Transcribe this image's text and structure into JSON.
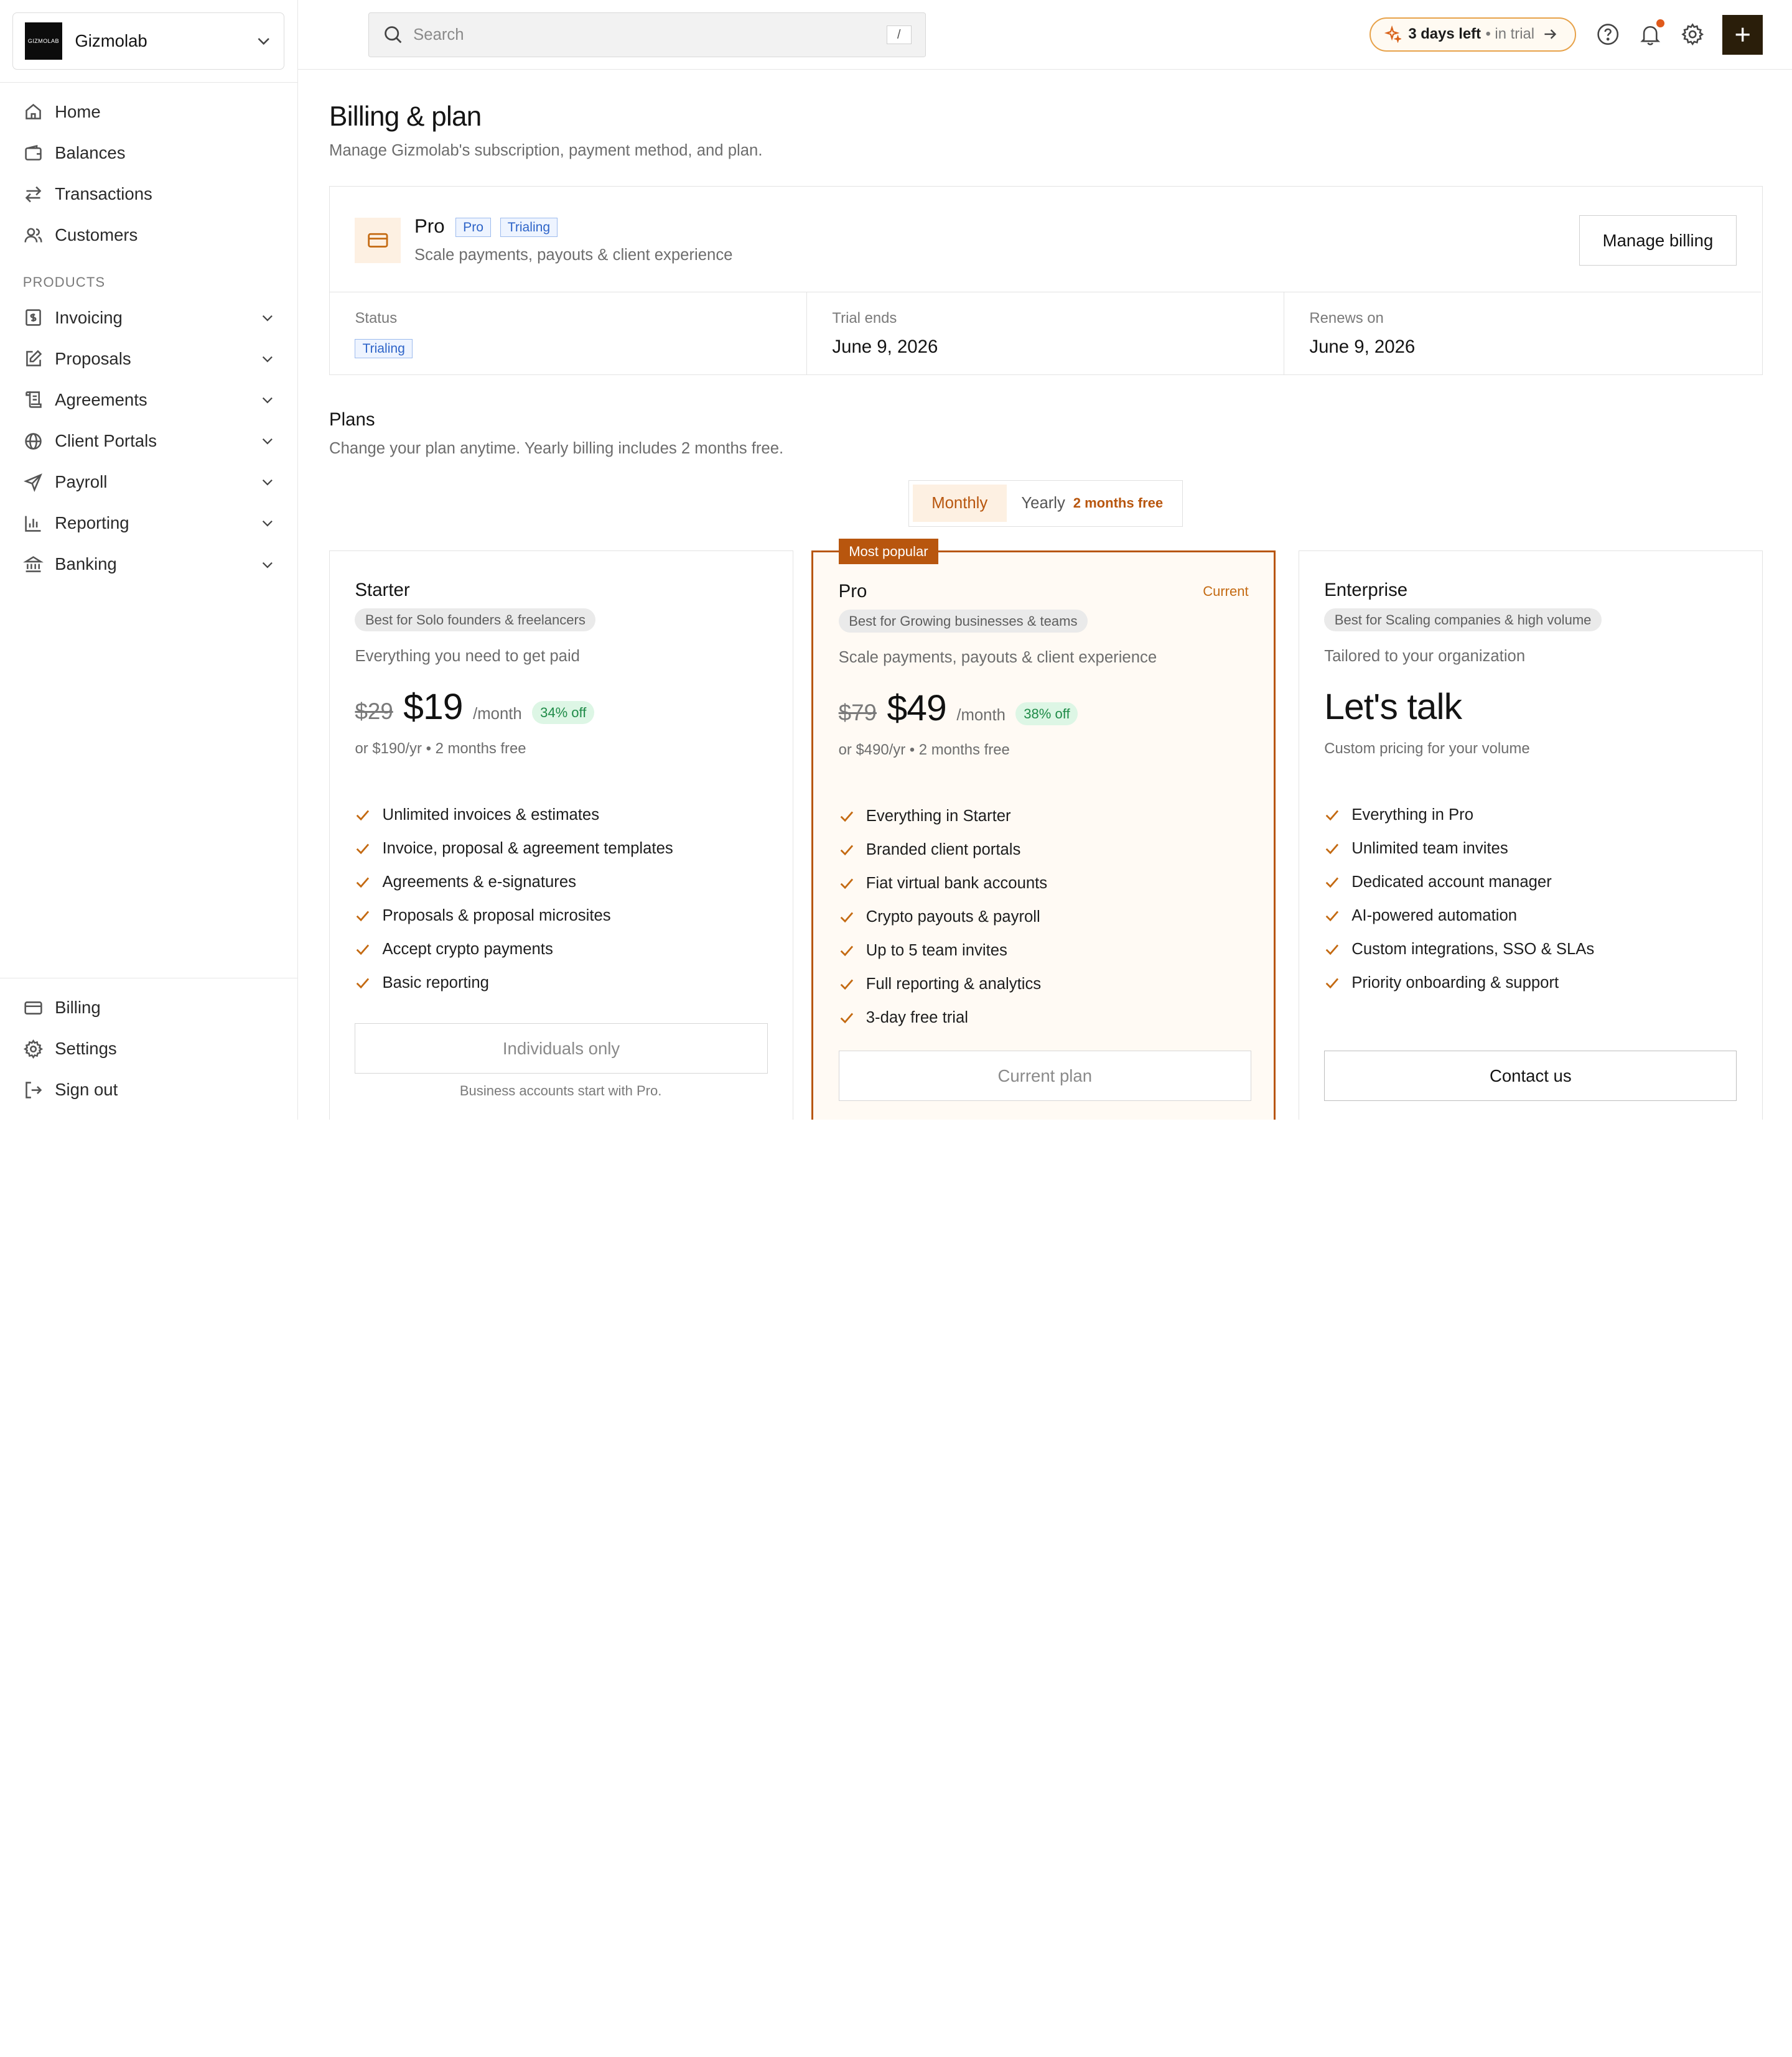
{
  "workspace": {
    "name": "Gizmolab",
    "logo_text": "GIZMOLAB"
  },
  "nav": {
    "main": [
      {
        "label": "Home",
        "icon": "home-icon"
      },
      {
        "label": "Balances",
        "icon": "wallet-icon"
      },
      {
        "label": "Transactions",
        "icon": "transfer-icon"
      },
      {
        "label": "Customers",
        "icon": "users-icon"
      }
    ],
    "section_label": "PRODUCTS",
    "products": [
      {
        "label": "Invoicing",
        "icon": "invoice-icon"
      },
      {
        "label": "Proposals",
        "icon": "edit-icon"
      },
      {
        "label": "Agreements",
        "icon": "scroll-icon"
      },
      {
        "label": "Client Portals",
        "icon": "globe-icon"
      },
      {
        "label": "Payroll",
        "icon": "send-icon"
      },
      {
        "label": "Reporting",
        "icon": "chart-icon"
      },
      {
        "label": "Banking",
        "icon": "bank-icon"
      }
    ],
    "bottom": [
      {
        "label": "Billing",
        "icon": "card-icon"
      },
      {
        "label": "Settings",
        "icon": "gear-icon"
      },
      {
        "label": "Sign out",
        "icon": "signout-icon"
      }
    ]
  },
  "topbar": {
    "search_placeholder": "Search",
    "search_shortcut": "/",
    "trial_bold": "3 days left",
    "trial_muted": "• in trial",
    "accent": "#b8560e"
  },
  "page": {
    "title": "Billing & plan",
    "subtitle": "Manage Gizmolab's subscription, payment method, and plan."
  },
  "current_plan": {
    "name": "Pro",
    "tags": [
      "Pro",
      "Trialing"
    ],
    "description": "Scale payments, payouts & client experience",
    "manage_label": "Manage billing",
    "status_label": "Status",
    "status_value": "Trialing",
    "trial_ends_label": "Trial ends",
    "trial_ends_value": "June 9, 2026",
    "renews_label": "Renews on",
    "renews_value": "June 9, 2026"
  },
  "plans": {
    "title": "Plans",
    "subtitle": "Change your plan anytime. Yearly billing includes 2 months free.",
    "toggle": {
      "monthly": "Monthly",
      "yearly": "Yearly",
      "yearly_badge": "2 months free",
      "selected": "Monthly"
    },
    "tiers": [
      {
        "name": "Starter",
        "best_for": "Best for Solo founders & freelancers",
        "description": "Everything you need to get paid",
        "old_price": "$29",
        "price": "$19",
        "period": "/month",
        "discount": "34% off",
        "yearly": "or $190/yr • 2 months free",
        "features": [
          "Unlimited invoices & estimates",
          "Invoice, proposal & agreement templates",
          "Agreements & e-signatures",
          "Proposals & proposal microsites",
          "Accept crypto payments",
          "Basic reporting"
        ],
        "button": "Individuals only",
        "footnote": "Business accounts start with Pro."
      },
      {
        "name": "Pro",
        "popular_badge": "Most popular",
        "current_label": "Current",
        "best_for": "Best for Growing businesses & teams",
        "description": "Scale payments, payouts & client experience",
        "old_price": "$79",
        "price": "$49",
        "period": "/month",
        "discount": "38% off",
        "yearly": "or $490/yr • 2 months free",
        "features": [
          "Everything in Starter",
          "Branded client portals",
          "Fiat virtual bank accounts",
          "Crypto payouts & payroll",
          "Up to 5 team invites",
          "Full reporting & analytics",
          "3-day free trial"
        ],
        "button": "Current plan"
      },
      {
        "name": "Enterprise",
        "best_for": "Best for Scaling companies & high volume",
        "description": "Tailored to your organization",
        "price": "Let's talk",
        "yearly": "Custom pricing for your volume",
        "features": [
          "Everything in Pro",
          "Unlimited team invites",
          "Dedicated account manager",
          "AI-powered automation",
          "Custom integrations, SSO & SLAs",
          "Priority onboarding & support"
        ],
        "button": "Contact us"
      }
    ]
  }
}
